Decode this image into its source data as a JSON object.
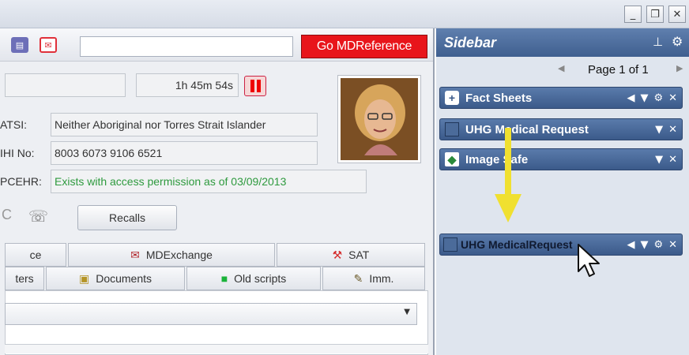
{
  "toolbar": {
    "go_button": "Go MDReference"
  },
  "patient": {
    "timer": "1h 45m 54s",
    "atsi_label": "ATSI:",
    "atsi_value": "Neither Aboriginal nor Torres Strait Islander",
    "ihi_label": "IHI No:",
    "ihi_value": "8003 6073 9106 6521",
    "pcehr_label": "PCEHR:",
    "pcehr_value": "Exists with access permission as of 03/09/2013"
  },
  "buttons": {
    "recalls": "Recalls"
  },
  "tabs": {
    "row1": [
      "ce",
      "MDExchange",
      "SAT"
    ],
    "row2": [
      "ters",
      "Documents",
      "Old scripts",
      "Imm."
    ]
  },
  "sidebar": {
    "title": "Sidebar",
    "page_label": "Page 1 of 1",
    "panels": [
      "Fact Sheets",
      "UHG Medical Request",
      "Image Safe"
    ],
    "dragged_panel": "UHG MedicalRequest"
  },
  "colors": {
    "accent": "#e8151b",
    "sidebar_header": "#3f5f8f",
    "pcehr_text": "#2e9a3e",
    "arrow": "#f0e030"
  }
}
